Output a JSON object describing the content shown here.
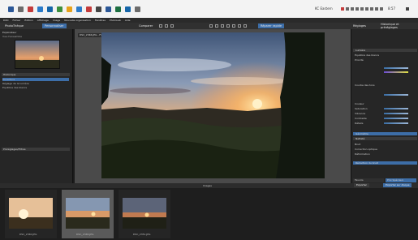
{
  "taskbar": {
    "tray_label": "KC Eastern",
    "clock": "8:57"
  },
  "menubar": {
    "items": [
      "DXO",
      "Fichier",
      "Edition",
      "Affichage",
      "Image",
      "Nouvelle organisation",
      "Fenêtres",
      "PhotoLab",
      "Aide"
    ]
  },
  "toolbar": {
    "tab_photothek": "PhotoThèque",
    "tab_personnaliser": "Personnaliser",
    "compare_label": "Comparer",
    "repair_label": "Réparer rapide",
    "right_tabs": [
      "Réglages",
      "Historique et préréglages"
    ]
  },
  "left_panel": {
    "title": "Explorateur",
    "image_info_label": "Vue d'ensemble",
    "history_header": "Historique",
    "history_items": [
      "Ouverture",
      "Réglage de la lumière",
      "Equilibre des blancs"
    ],
    "presets_header": "Préréglages/Filtres"
  },
  "viewer": {
    "filename": "DSC_2346.JPG - F/8 1/200s ISO 100"
  },
  "right_panel": {
    "sections": [
      "Lumière",
      "Équilibre des blancs",
      "Priorité",
      "Courbe des tons",
      "Couleur",
      "Saturation",
      "Vibrance",
      "Contraste",
      "Détails",
      "Géométrie",
      "Netteté",
      "Bruit",
      "Correction optique",
      "Déformation",
      "Réduction du bruit"
    ],
    "bottom_labels": [
      "Favoris",
      "Prix Spéciaux"
    ]
  },
  "filmstrip": {
    "toolbar_label": "Images",
    "thumbs": [
      {
        "caption": "DSC_2340.JPG"
      },
      {
        "caption": "DSC_2346.JPG"
      },
      {
        "caption": "DSC_2351.JPG"
      }
    ],
    "export_button": "Exporter",
    "export_disk_button": "Exporter sur disque"
  }
}
